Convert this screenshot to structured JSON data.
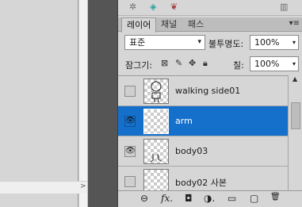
{
  "top_tools": {
    "icons": [
      "sun-icon",
      "swap-icon",
      "brush-icon",
      "trash-icon"
    ]
  },
  "tabs": [
    {
      "label": "레이어",
      "active": true
    },
    {
      "label": "채널",
      "active": false
    },
    {
      "label": "패스",
      "active": false
    }
  ],
  "blend": {
    "mode": "표준",
    "opacity_label": "불투명도:",
    "opacity": "100%"
  },
  "lock": {
    "label": "잠그기:",
    "fill_label": "칠:",
    "fill": "100%"
  },
  "layers": [
    {
      "name": "walking side01",
      "visible": false,
      "selected": false
    },
    {
      "name": "arm",
      "visible": true,
      "selected": true
    },
    {
      "name": "body03",
      "visible": true,
      "selected": false
    },
    {
      "name": "body02 사본",
      "visible": false,
      "selected": false
    }
  ],
  "bottom_icons": [
    "link-icon",
    "fx-icon",
    "mask-icon",
    "adjustment-icon",
    "folder-icon",
    "new-layer-icon",
    "delete-icon"
  ],
  "bottom_glyphs": {
    "link": "⊖",
    "fx": "fx.",
    "mask": "◘",
    "adjust": "◑.",
    "folder": "▭",
    "new": "▢",
    "del": "🗑"
  },
  "glyphs": {
    "eye": "👁",
    "chev": "▾",
    "menu": "▾≡"
  }
}
